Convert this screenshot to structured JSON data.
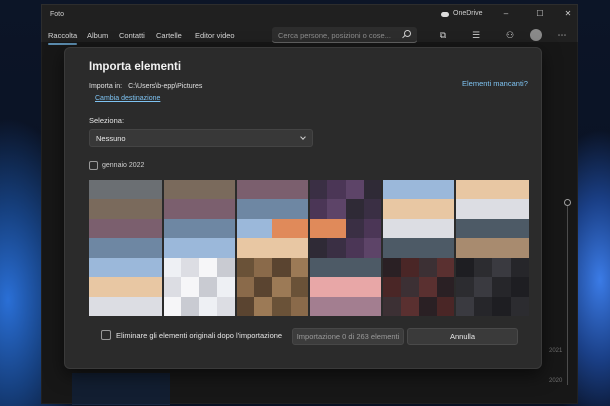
{
  "window": {
    "title": "Foto",
    "onedrive_label": "OneDrive",
    "controls": [
      "minimize-icon",
      "maximize-icon",
      "close-icon"
    ]
  },
  "nav": {
    "tabs": [
      {
        "label": "Raccolta",
        "active": true
      },
      {
        "label": "Album",
        "active": false
      },
      {
        "label": "Contatti",
        "active": false
      },
      {
        "label": "Cartelle",
        "active": false
      },
      {
        "label": "Editor video",
        "active": false
      }
    ],
    "search_placeholder": "Cerca persone, posizioni o cose...",
    "tool_icons": [
      "import-icon",
      "select-icon",
      "share-icon",
      "avatar",
      "more-icon"
    ]
  },
  "timeline": {
    "years": [
      "2021",
      "2020"
    ]
  },
  "dialog": {
    "title": "Importa elementi",
    "missing_link": "Elementi mancanti?",
    "import_path_label": "Importa in:",
    "import_path_value": "C:\\Users\\b-epp\\Pictures",
    "change_destination": "Cambia destinazione",
    "select_label": "Seleziona:",
    "select_value": "Nessuno",
    "month_label": "gennaio 2022",
    "delete_originals_label": "Eliminare gli elementi originali dopo l'importazione",
    "import_button": "Importazione 0 di 263 elementi",
    "cancel_button": "Annulla"
  }
}
